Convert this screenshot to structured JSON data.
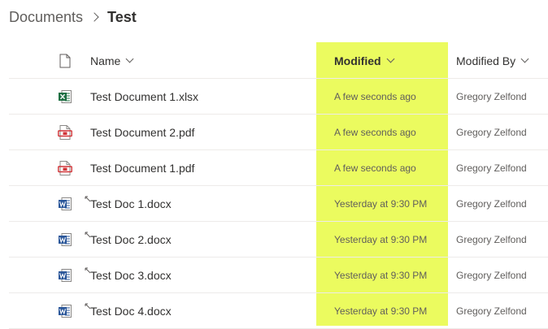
{
  "breadcrumb": {
    "parent": "Documents",
    "current": "Test"
  },
  "columns": {
    "name": "Name",
    "modified": "Modified",
    "modified_by": "Modified By"
  },
  "colors": {
    "highlight": "#ebfb5f",
    "excel": "#1d6f42",
    "pdf": "#d13438",
    "word": "#2b579a"
  },
  "files": [
    {
      "name": "Test Document 1.xlsx",
      "type": "xlsx",
      "icon": "excel-file-icon",
      "modified": "A few seconds ago",
      "modified_by": "Gregory Zelfond",
      "recent_sync": false
    },
    {
      "name": "Test Document 2.pdf",
      "type": "pdf",
      "icon": "pdf-file-icon",
      "modified": "A few seconds ago",
      "modified_by": "Gregory Zelfond",
      "recent_sync": false
    },
    {
      "name": "Test Document 1.pdf",
      "type": "pdf",
      "icon": "pdf-file-icon",
      "modified": "A few seconds ago",
      "modified_by": "Gregory Zelfond",
      "recent_sync": false
    },
    {
      "name": "Test Doc 1.docx",
      "type": "docx",
      "icon": "word-file-icon",
      "modified": "Yesterday at 9:30 PM",
      "modified_by": "Gregory Zelfond",
      "recent_sync": true
    },
    {
      "name": "Test Doc 2.docx",
      "type": "docx",
      "icon": "word-file-icon",
      "modified": "Yesterday at 9:30 PM",
      "modified_by": "Gregory Zelfond",
      "recent_sync": true
    },
    {
      "name": "Test Doc 3.docx",
      "type": "docx",
      "icon": "word-file-icon",
      "modified": "Yesterday at 9:30 PM",
      "modified_by": "Gregory Zelfond",
      "recent_sync": true
    },
    {
      "name": "Test Doc 4.docx",
      "type": "docx",
      "icon": "word-file-icon",
      "modified": "Yesterday at 9:30 PM",
      "modified_by": "Gregory Zelfond",
      "recent_sync": true
    }
  ]
}
